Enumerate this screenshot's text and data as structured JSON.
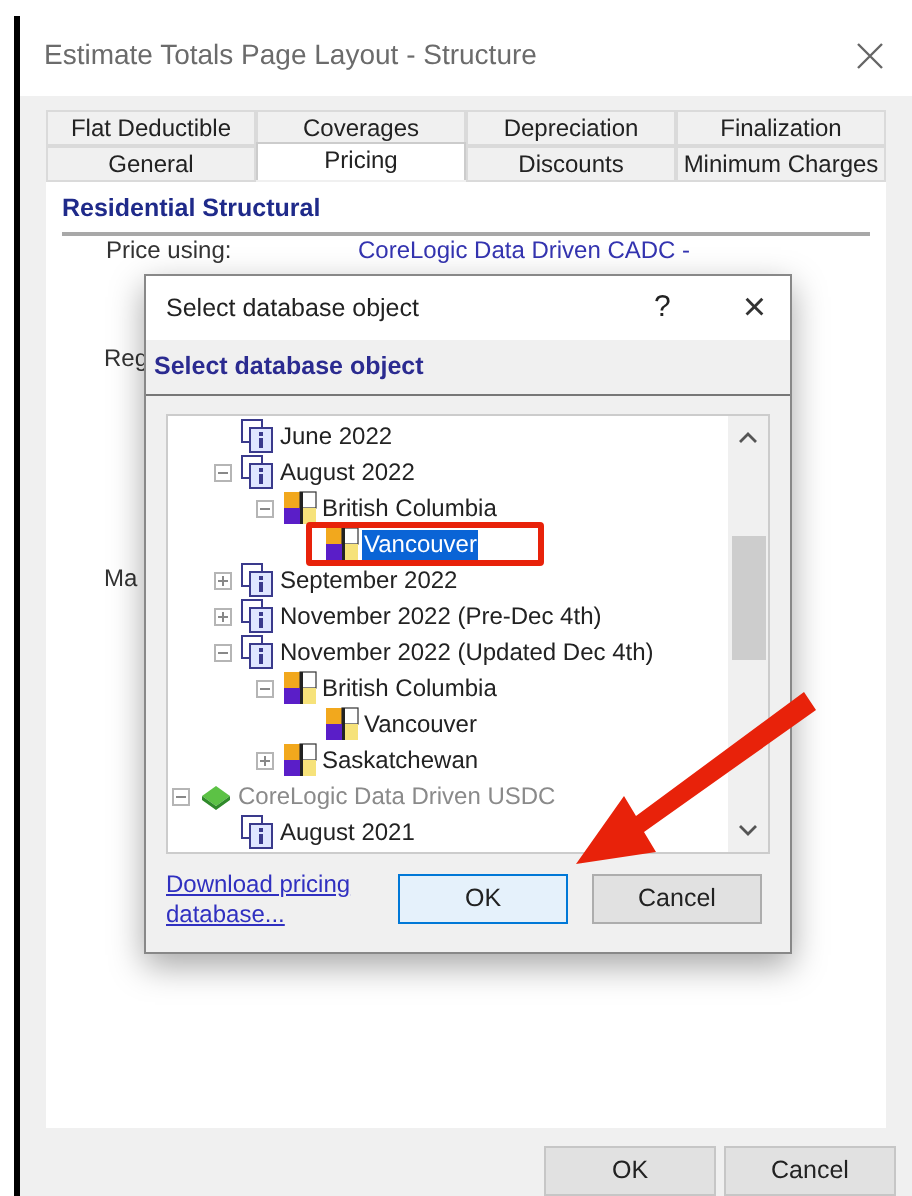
{
  "window": {
    "title": "Estimate Totals Page Layout - Structure"
  },
  "tabs": [
    [
      {
        "label": "Flat Deductible",
        "selected": false
      },
      {
        "label": "Coverages",
        "selected": false
      },
      {
        "label": "Depreciation",
        "selected": false
      },
      {
        "label": "Finalization",
        "selected": false
      }
    ],
    [
      {
        "label": "General",
        "selected": false
      },
      {
        "label": "Pricing",
        "selected": true
      },
      {
        "label": "Discounts",
        "selected": false
      },
      {
        "label": "Minimum Charges",
        "selected": false
      }
    ]
  ],
  "section": {
    "heading": "Residential Structural",
    "fields": [
      {
        "label": "Price using:",
        "value": "CoreLogic Data Driven CADC -"
      },
      {
        "label": "Reg"
      },
      {
        "label": "Ma"
      }
    ]
  },
  "dialog": {
    "title": "Select database object",
    "help": "?",
    "close": "×",
    "heading": "Select database object",
    "tree": [
      {
        "children": [
          {
            "kind": "version",
            "label": "June 2022"
          },
          {
            "kind": "version",
            "label": "August 2022",
            "expanded": true,
            "children": [
              {
                "kind": "region",
                "label": "British Columbia",
                "expanded": true,
                "children": [
                  {
                    "kind": "region",
                    "label": "Vancouver",
                    "selected": true
                  }
                ]
              }
            ]
          },
          {
            "kind": "version",
            "label": "September 2022",
            "expanded": false
          },
          {
            "kind": "version",
            "label": "November 2022 (Pre-Dec 4th)",
            "expanded": false
          },
          {
            "kind": "version",
            "label": "November 2022 (Updated Dec 4th)",
            "expanded": true,
            "children": [
              {
                "kind": "region",
                "label": "British Columbia",
                "expanded": true,
                "children": [
                  {
                    "kind": "region",
                    "label": "Vancouver",
                    "selected": false
                  }
                ]
              },
              {
                "kind": "region",
                "label": "Saskatchewan",
                "expanded": false
              }
            ]
          }
        ]
      },
      {
        "kind": "database",
        "label": "CoreLogic Data Driven USDC",
        "expanded": true,
        "disabled": true,
        "children": [
          {
            "kind": "version",
            "label": "August 2021"
          }
        ]
      }
    ],
    "link": "Download pricing database...",
    "buttons": [
      {
        "label": "OK",
        "default": true
      },
      {
        "label": "Cancel",
        "default": false
      }
    ]
  },
  "buttons": [
    {
      "label": "OK"
    },
    {
      "label": "Cancel"
    }
  ]
}
